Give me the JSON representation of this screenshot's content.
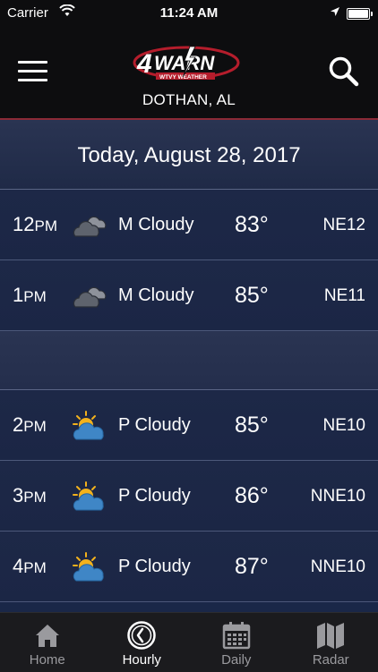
{
  "status_bar": {
    "carrier": "Carrier",
    "time": "11:24 AM"
  },
  "header": {
    "logo_text": "WARN",
    "logo_number": "4",
    "logo_sub": "WTVY WEATHER",
    "city": "DOTHAN, AL"
  },
  "date_band": {
    "text": "Today, August 28, 2017"
  },
  "rows": [
    {
      "hour": "12",
      "ampm": "PM",
      "icon": "mostly-cloudy-icon",
      "condition": "M Cloudy",
      "temp": "83°",
      "wind": "NE12"
    },
    {
      "hour": "1",
      "ampm": "PM",
      "icon": "mostly-cloudy-icon",
      "condition": "M Cloudy",
      "temp": "85°",
      "wind": "NE11"
    },
    {
      "hour": "2",
      "ampm": "PM",
      "icon": "partly-cloudy-icon",
      "condition": "P Cloudy",
      "temp": "85°",
      "wind": "NE10"
    },
    {
      "hour": "3",
      "ampm": "PM",
      "icon": "partly-cloudy-icon",
      "condition": "P Cloudy",
      "temp": "86°",
      "wind": "NNE10"
    },
    {
      "hour": "4",
      "ampm": "PM",
      "icon": "partly-cloudy-icon",
      "condition": "P Cloudy",
      "temp": "87°",
      "wind": "NNE10"
    }
  ],
  "tabs": [
    {
      "label": "Home",
      "icon": "home-icon",
      "active": false
    },
    {
      "label": "Hourly",
      "icon": "clock-icon",
      "active": true
    },
    {
      "label": "Daily",
      "icon": "calendar-icon",
      "active": false
    },
    {
      "label": "Radar",
      "icon": "map-icon",
      "active": false
    }
  ],
  "colors": {
    "header_bg": "#0d0d0f",
    "accent_red": "#8a2a36",
    "row_bg": "#1d2847",
    "tab_inactive": "#9a9a9e",
    "sun": "#f3b21c",
    "cloud_blue": "#3f86c6"
  }
}
